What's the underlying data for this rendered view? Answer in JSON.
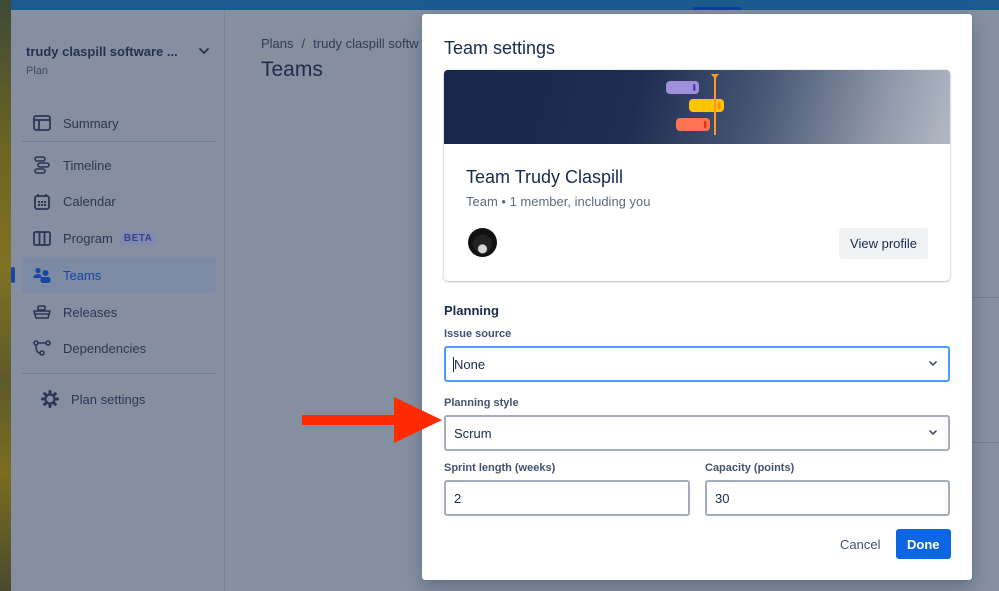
{
  "sidebar": {
    "project_name": "trudy claspill software ...",
    "project_type": "Plan",
    "items": [
      {
        "label": "Summary",
        "icon": "summary-icon"
      },
      {
        "label": "Timeline",
        "icon": "timeline-icon"
      },
      {
        "label": "Calendar",
        "icon": "calendar-icon"
      },
      {
        "label": "Program",
        "icon": "program-icon",
        "badge": "BETA"
      },
      {
        "label": "Teams",
        "icon": "teams-icon",
        "active": true
      },
      {
        "label": "Releases",
        "icon": "releases-icon"
      },
      {
        "label": "Dependencies",
        "icon": "dependencies-icon"
      }
    ],
    "settings_label": "Plan settings"
  },
  "main": {
    "breadcrumb": [
      "Plans",
      "trudy claspill softw"
    ],
    "breadcrumb_separator": "/",
    "title": "Teams"
  },
  "modal": {
    "title": "Team settings",
    "team": {
      "name": "Team Trudy Claspill",
      "meta": "Team • 1 member, including you",
      "view_profile_label": "View profile"
    },
    "planning_title": "Planning",
    "issue_source": {
      "label": "Issue source",
      "value": "None"
    },
    "planning_style": {
      "label": "Planning style",
      "value": "Scrum"
    },
    "sprint_length": {
      "label": "Sprint length (weeks)",
      "value": "2"
    },
    "capacity": {
      "label": "Capacity (points)",
      "value": "30"
    },
    "cancel_label": "Cancel",
    "done_label": "Done"
  },
  "colors": {
    "primary": "#0c66e4",
    "focus_border": "#4c9aff",
    "annotation_arrow": "#ff2a00"
  }
}
